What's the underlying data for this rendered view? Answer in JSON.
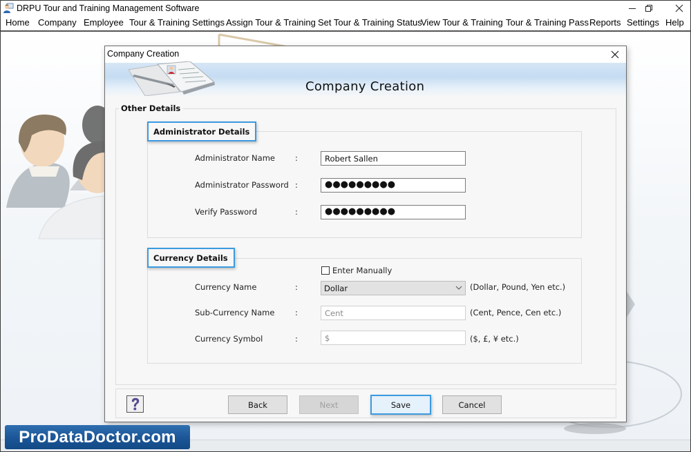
{
  "window": {
    "title": "DRPU Tour and Training Management Software",
    "controls": [
      "minimize",
      "restore",
      "close"
    ]
  },
  "menu": {
    "items": [
      {
        "label": "Home"
      },
      {
        "label": "Company"
      },
      {
        "label": "Employee"
      },
      {
        "label": "Tour & Training Settings"
      },
      {
        "label": "Assign Tour & Training"
      },
      {
        "label": "Set Tour & Training Status"
      },
      {
        "label": "View Tour & Training"
      },
      {
        "label": "Tour & Training Pass"
      },
      {
        "label": "Reports"
      },
      {
        "label": "Settings"
      },
      {
        "label": "Help"
      }
    ]
  },
  "dialog": {
    "window_title": "Company Creation",
    "banner_title": "Company Creation",
    "outer_group_label": "Other Details",
    "admin": {
      "group_label": "Administrator Details",
      "fields": [
        {
          "label": "Administrator Name",
          "colon": ":",
          "value": "Robert Sallen",
          "type": "text"
        },
        {
          "label": "Administrator Password",
          "colon": ":",
          "value": "●●●●●●●●●",
          "type": "password"
        },
        {
          "label": "Verify Password",
          "colon": ":",
          "value": "●●●●●●●●●",
          "type": "password"
        }
      ]
    },
    "currency": {
      "group_label": "Currency Details",
      "enter_manually": {
        "label": "Enter Manually",
        "checked": false
      },
      "fields": [
        {
          "label": "Currency Name",
          "colon": ":",
          "value": "Dollar",
          "type": "select",
          "hint": "(Dollar, Pound, Yen etc.)"
        },
        {
          "label": "Sub-Currency Name",
          "colon": ":",
          "value": "Cent",
          "type": "text-disabled",
          "hint": "(Cent, Pence, Cen etc.)"
        },
        {
          "label": "Currency Symbol",
          "colon": ":",
          "value": "$",
          "type": "text-disabled",
          "hint": "($, £, ¥ etc.)"
        }
      ]
    },
    "buttons": {
      "help": "?",
      "back": "Back",
      "next": "Next",
      "save": "Save",
      "cancel": "Cancel"
    }
  },
  "watermark": "ProDataDoctor.com",
  "colors": {
    "accent_focus": "#3b9ae1",
    "watermark_bg": "#1b5596",
    "banner_blue": "#c5dcf2"
  }
}
